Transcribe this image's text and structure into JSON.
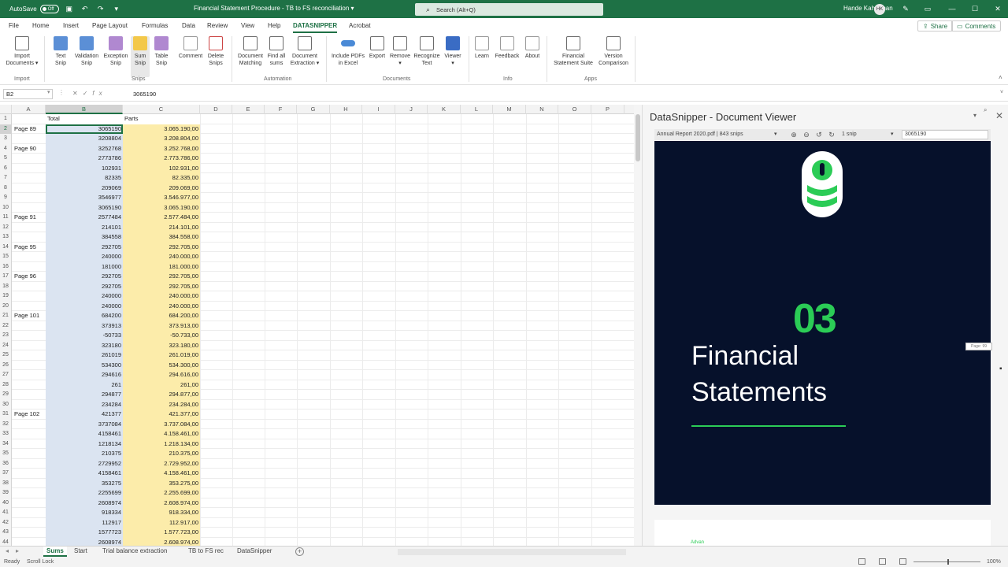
{
  "titlebar": {
    "autosave_label": "AutoSave",
    "autosave_state": "Off",
    "document_title": "Financial Statement Procedure - TB to FS reconciliation",
    "search_placeholder": "Search (Alt+Q)",
    "user_name": "Hande Kahraman",
    "user_initials": "HK"
  },
  "menu": {
    "tabs": [
      "File",
      "Home",
      "Insert",
      "Page Layout",
      "Formulas",
      "Data",
      "Review",
      "View",
      "Help",
      "DATASNIPPER",
      "Acrobat"
    ],
    "active": "DATASNIPPER",
    "share_label": "Share",
    "comments_label": "Comments"
  },
  "ribbon": {
    "groups": {
      "import": "Import",
      "snips": "Snips",
      "automation": "Automation",
      "documents": "Documents",
      "info": "Info",
      "apps": "Apps"
    },
    "buttons": {
      "import_documents": [
        "Import",
        "Documents ▾"
      ],
      "text_snip": [
        "Text",
        "Snip"
      ],
      "validation_snip": [
        "Validation",
        "Snip"
      ],
      "exception_snip": [
        "Exception",
        "Snip"
      ],
      "sum_snip": [
        "Sum",
        "Snip"
      ],
      "table_snip": [
        "Table",
        "Snip"
      ],
      "comment": [
        "Comment",
        ""
      ],
      "delete_snips": [
        "Delete",
        "Snips"
      ],
      "document_matching": [
        "Document",
        "Matching"
      ],
      "find_all_sums": [
        "Find all",
        "sums"
      ],
      "document_extraction": [
        "Document",
        "Extraction ▾"
      ],
      "include_pdfs": [
        "Include PDFs",
        "in Excel"
      ],
      "export": [
        "Export",
        ""
      ],
      "remove": [
        "Remove",
        "▾"
      ],
      "recognize_text": [
        "Recognize",
        "Text"
      ],
      "viewer": [
        "Viewer",
        "▾"
      ],
      "learn": [
        "Learn",
        ""
      ],
      "feedback": [
        "Feedback",
        ""
      ],
      "about": [
        "About",
        ""
      ],
      "fs_suite": [
        "Financial",
        "Statement Suite"
      ],
      "version_comparison": [
        "Version",
        "Comparison"
      ]
    }
  },
  "formula_bar": {
    "cell_ref": "B2",
    "value": "3065190"
  },
  "grid": {
    "columns": [
      "A",
      "B",
      "C",
      "D",
      "E",
      "F",
      "G",
      "H",
      "I",
      "J",
      "K",
      "L",
      "M",
      "N",
      "O",
      "P"
    ],
    "selected_column": "B",
    "header_row": {
      "b": "Total",
      "c": "Parts"
    },
    "rows": [
      {
        "n": "2",
        "a": "Page 89",
        "b": "3065190",
        "c": "3.065.190,00"
      },
      {
        "n": "3",
        "a": "",
        "b": "3208804",
        "c": "3.208.804,00"
      },
      {
        "n": "4",
        "a": "Page 90",
        "b": "3252768",
        "c": "3.252.768,00"
      },
      {
        "n": "5",
        "a": "",
        "b": "2773786",
        "c": "2.773.786,00"
      },
      {
        "n": "6",
        "a": "",
        "b": "102931",
        "c": "102.931,00"
      },
      {
        "n": "7",
        "a": "",
        "b": "82335",
        "c": "82.335,00"
      },
      {
        "n": "8",
        "a": "",
        "b": "209069",
        "c": "209.069,00"
      },
      {
        "n": "9",
        "a": "",
        "b": "3546977",
        "c": "3.546.977,00"
      },
      {
        "n": "10",
        "a": "",
        "b": "3065190",
        "c": "3.065.190,00"
      },
      {
        "n": "11",
        "a": "Page 91",
        "b": "2577484",
        "c": "2.577.484,00"
      },
      {
        "n": "12",
        "a": "",
        "b": "214101",
        "c": "214.101,00"
      },
      {
        "n": "13",
        "a": "",
        "b": "384558",
        "c": "384.558,00"
      },
      {
        "n": "14",
        "a": "Page 95",
        "b": "292705",
        "c": "292.705,00"
      },
      {
        "n": "15",
        "a": "",
        "b": "240000",
        "c": "240.000,00"
      },
      {
        "n": "16",
        "a": "",
        "b": "181000",
        "c": "181.000,00"
      },
      {
        "n": "17",
        "a": "Page 96",
        "b": "292705",
        "c": "292.705,00"
      },
      {
        "n": "18",
        "a": "",
        "b": "292705",
        "c": "292.705,00"
      },
      {
        "n": "19",
        "a": "",
        "b": "240000",
        "c": "240.000,00"
      },
      {
        "n": "20",
        "a": "",
        "b": "240000",
        "c": "240.000,00"
      },
      {
        "n": "21",
        "a": "Page 101",
        "b": "684200",
        "c": "684.200,00"
      },
      {
        "n": "22",
        "a": "",
        "b": "373913",
        "c": "373.913,00"
      },
      {
        "n": "23",
        "a": "",
        "b": "-50733",
        "c": "-50.733,00"
      },
      {
        "n": "24",
        "a": "",
        "b": "323180",
        "c": "323.180,00"
      },
      {
        "n": "25",
        "a": "",
        "b": "261019",
        "c": "261.019,00"
      },
      {
        "n": "26",
        "a": "",
        "b": "534300",
        "c": "534.300,00"
      },
      {
        "n": "27",
        "a": "",
        "b": "294616",
        "c": "294.616,00"
      },
      {
        "n": "28",
        "a": "",
        "b": "261",
        "c": "261,00"
      },
      {
        "n": "29",
        "a": "",
        "b": "294877",
        "c": "294.877,00"
      },
      {
        "n": "30",
        "a": "",
        "b": "234284",
        "c": "234.284,00"
      },
      {
        "n": "31",
        "a": "Page 102",
        "b": "421377",
        "c": "421.377,00"
      },
      {
        "n": "32",
        "a": "",
        "b": "3737084",
        "c": "3.737.084,00"
      },
      {
        "n": "33",
        "a": "",
        "b": "4158461",
        "c": "4.158.461,00"
      },
      {
        "n": "34",
        "a": "",
        "b": "1218134",
        "c": "1.218.134,00"
      },
      {
        "n": "35",
        "a": "",
        "b": "210375",
        "c": "210.375,00"
      },
      {
        "n": "36",
        "a": "",
        "b": "2729952",
        "c": "2.729.952,00"
      },
      {
        "n": "37",
        "a": "",
        "b": "4158461",
        "c": "4.158.461,00"
      },
      {
        "n": "38",
        "a": "",
        "b": "353275",
        "c": "353.275,00"
      },
      {
        "n": "39",
        "a": "",
        "b": "2255699",
        "c": "2.255.699,00"
      },
      {
        "n": "40",
        "a": "",
        "b": "2608974",
        "c": "2.608.974,00"
      },
      {
        "n": "41",
        "a": "",
        "b": "918334",
        "c": "918.334,00"
      },
      {
        "n": "42",
        "a": "",
        "b": "112917",
        "c": "112.917,00"
      },
      {
        "n": "43",
        "a": "",
        "b": "1577723",
        "c": "1.577.723,00"
      },
      {
        "n": "44",
        "a": "",
        "b": "2608974",
        "c": "2.608.974,00"
      }
    ]
  },
  "sheets": {
    "tabs": [
      "Sums",
      "Start",
      "Trial balance extraction",
      "TB to FS rec",
      "DataSnipper"
    ],
    "active": "Sums"
  },
  "status": {
    "ready": "Ready",
    "scroll_lock": "Scroll Lock",
    "zoom": "100%"
  },
  "viewer": {
    "title": "DataSnipper - Document Viewer",
    "document": "Annual Report 2020.pdf | 843 snips",
    "snips": "1 snip",
    "search_value": "3065190",
    "page_number": "03",
    "page_title_1": "Financial",
    "page_title_2": "Statements",
    "page_tag": "Page: 99",
    "next_page_text": "Advan"
  },
  "colors": {
    "excel_green": "#1e7145",
    "total_fill": "#dbe4f1",
    "parts_fill": "#fcecaa",
    "page_bg": "#06112b",
    "accent_green": "#2bcc56"
  },
  "icons": {
    "save": "save-icon",
    "undo": "undo-icon",
    "redo": "redo-icon",
    "search": "search-icon",
    "close": "close-icon",
    "zoom_in": "zoom-in-icon",
    "zoom_out": "zoom-out-icon",
    "rotate": "rotate-icon"
  }
}
